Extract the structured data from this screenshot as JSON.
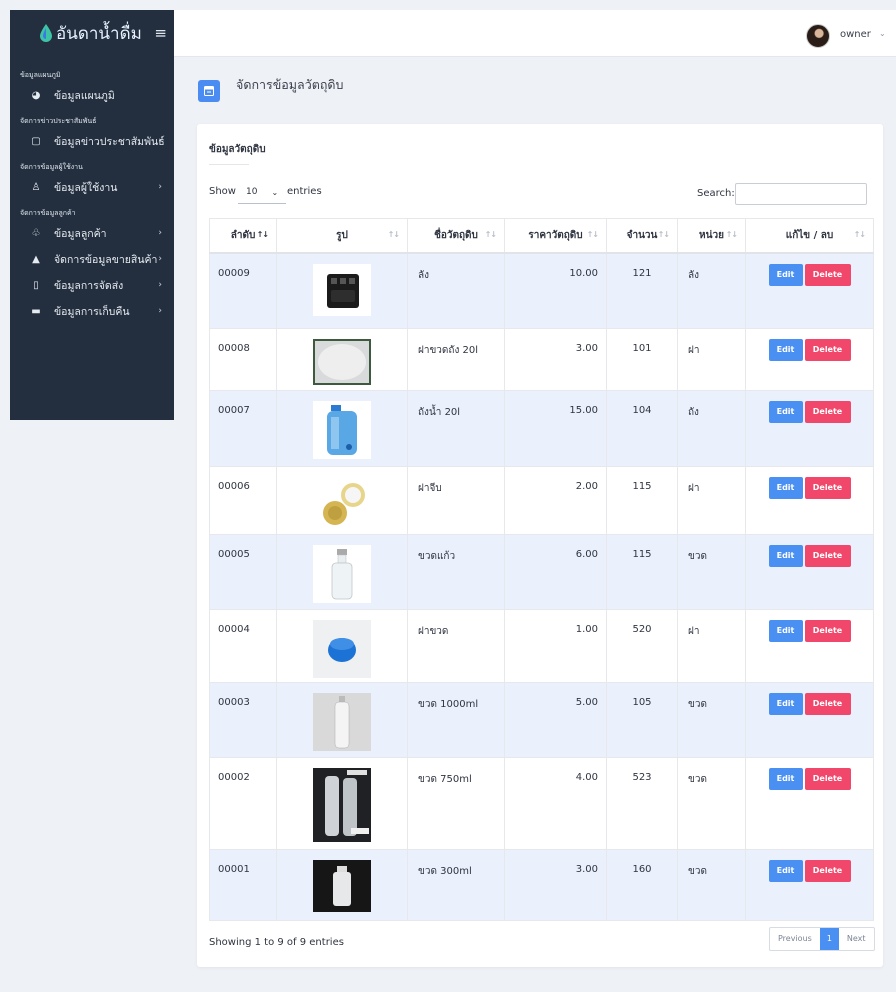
{
  "brand": {
    "name": "อันดาน้ำดื่ม"
  },
  "topbar": {
    "username": "owner"
  },
  "sidebar": {
    "sections": [
      {
        "title": "ข้อมูลแผนภูมิ",
        "items": [
          {
            "label": "ข้อมูลแผนภูมิ",
            "icon": "pie-chart-icon",
            "chevron": false
          }
        ]
      },
      {
        "title": "จัดการข่าวประชาสัมพันธ์",
        "items": [
          {
            "label": "ข้อมูลข่าวประชาสัมพันธ์",
            "icon": "clipboard-icon",
            "chevron": true
          }
        ]
      },
      {
        "title": "จัดการข้อมูลผู้ใช้งาน",
        "items": [
          {
            "label": "ข้อมูลผู้ใช้งาน",
            "icon": "user-icon",
            "chevron": true
          }
        ]
      },
      {
        "title": "จัดการข้อมูลลูกค้า",
        "items": [
          {
            "label": "ข้อมูลลูกค้า",
            "icon": "users-icon",
            "chevron": true
          },
          {
            "label": "จัดการข้อมูลขายสินค้า",
            "icon": "shopping-bag-icon",
            "chevron": true
          },
          {
            "label": "ข้อมูลการจัดส่ง",
            "icon": "box-icon",
            "chevron": true
          },
          {
            "label": "ข้อมูลการเก็บคืน",
            "icon": "truck-icon",
            "chevron": true
          }
        ]
      }
    ]
  },
  "page": {
    "title": "จัดการข้อมูลวัตถุดิบ"
  },
  "card": {
    "title": "ข้อมูลวัตถุดิบ"
  },
  "controls": {
    "show_label": "Show",
    "length_value": "10",
    "entries_label": "entries",
    "search_label": "Search:",
    "search_value": ""
  },
  "table": {
    "headers": [
      "ลำดับ",
      "รูป",
      "ชื่อวัตถุดิบ",
      "ราคาวัตถุดิบ",
      "จำนวน",
      "หน่วย",
      "แก้ไข / ลบ"
    ],
    "rows": [
      {
        "id": "00009",
        "name": "ลัง",
        "price": "10.00",
        "qty": "121",
        "unit": "ลัง",
        "image": "crate"
      },
      {
        "id": "00008",
        "name": "ฝาขวดถัง 20l",
        "price": "3.00",
        "qty": "101",
        "unit": "ฝา",
        "image": "white-cap"
      },
      {
        "id": "00007",
        "name": "ถังน้ำ 20l",
        "price": "15.00",
        "qty": "104",
        "unit": "ถัง",
        "image": "water-tank"
      },
      {
        "id": "00006",
        "name": "ฝาจีบ",
        "price": "2.00",
        "qty": "115",
        "unit": "ฝา",
        "image": "crown-caps"
      },
      {
        "id": "00005",
        "name": "ขวดแก้ว",
        "price": "6.00",
        "qty": "115",
        "unit": "ขวด",
        "image": "glass-bottle"
      },
      {
        "id": "00004",
        "name": "ฝาขวด",
        "price": "1.00",
        "qty": "520",
        "unit": "ฝา",
        "image": "blue-cap"
      },
      {
        "id": "00003",
        "name": "ขวด 1000ml",
        "price": "5.00",
        "qty": "105",
        "unit": "ขวด",
        "image": "bottle-1000"
      },
      {
        "id": "00002",
        "name": "ขวด 750ml",
        "price": "4.00",
        "qty": "523",
        "unit": "ขวด",
        "image": "bottle-750"
      },
      {
        "id": "00001",
        "name": "ขวด 300ml",
        "price": "3.00",
        "qty": "160",
        "unit": "ขวด",
        "image": "bottle-300"
      }
    ],
    "edit_label": "Edit",
    "delete_label": "Delete"
  },
  "footer": {
    "info": "Showing 1 to 9 of 9 entries"
  },
  "pagination": {
    "previous": "Previous",
    "current": "1",
    "next": "Next"
  },
  "colors": {
    "sidebar_bg": "#232f3e",
    "accent_blue": "#4a90f2",
    "delete_red": "#f0476a",
    "row_highlight": "#eaf1fd"
  }
}
